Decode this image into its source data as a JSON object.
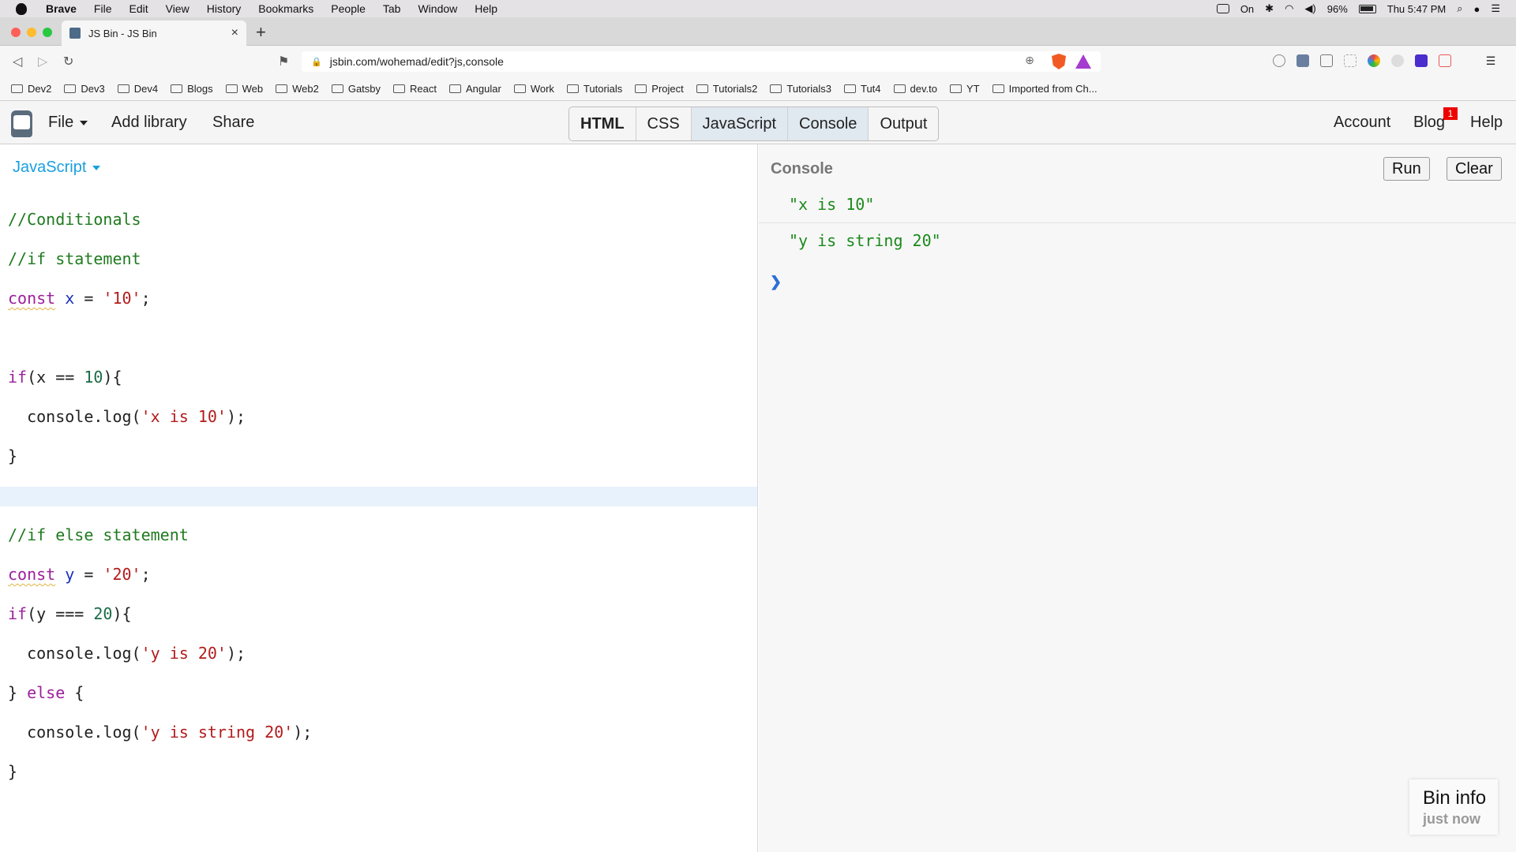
{
  "menubar": {
    "items": [
      "Brave",
      "File",
      "Edit",
      "View",
      "History",
      "Bookmarks",
      "People",
      "Tab",
      "Window",
      "Help"
    ],
    "right": {
      "vpn": "On",
      "battery": "96%",
      "clock": "Thu 5:47 PM"
    }
  },
  "browser": {
    "tab_title": "JS Bin - JS Bin",
    "url": "jsbin.com/wohemad/edit?js,console",
    "bookmarks": [
      "Dev2",
      "Dev3",
      "Dev4",
      "Blogs",
      "Web",
      "Web2",
      "Gatsby",
      "React",
      "Angular",
      "Work",
      "Tutorials",
      "Project",
      "Tutorials2",
      "Tutorials3",
      "Tut4",
      "dev.to",
      "YT",
      "Imported from Ch..."
    ]
  },
  "jsbin": {
    "file_label": "File",
    "add_library_label": "Add library",
    "share_label": "Share",
    "panels": [
      "HTML",
      "CSS",
      "JavaScript",
      "Console",
      "Output"
    ],
    "account_label": "Account",
    "blog_label": "Blog",
    "blog_badge": "1",
    "help_label": "Help"
  },
  "editor": {
    "language_label": "JavaScript"
  },
  "console": {
    "label": "Console",
    "run_label": "Run",
    "clear_label": "Clear",
    "outputs": [
      "\"x is 10\"",
      "\"y is string 20\""
    ],
    "prompt": "❯"
  },
  "bin_info": {
    "title": "Bin info",
    "subtitle": "just now"
  },
  "colors": {
    "accent": "#1a9fe0",
    "console_output": "#1b8a1b",
    "badge": "#e00000"
  }
}
